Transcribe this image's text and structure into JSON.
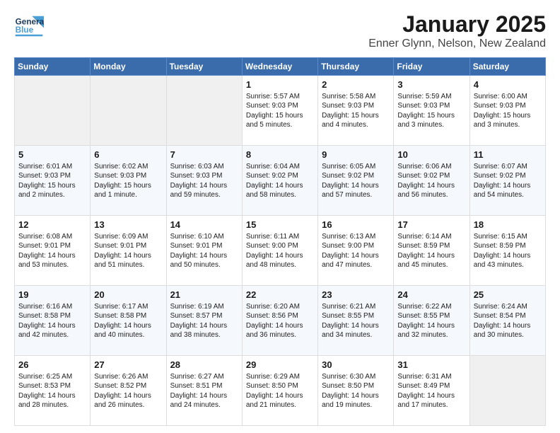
{
  "header": {
    "logo_line1": "General",
    "logo_line2": "Blue",
    "title": "January 2025",
    "subtitle": "Enner Glynn, Nelson, New Zealand"
  },
  "days_of_week": [
    "Sunday",
    "Monday",
    "Tuesday",
    "Wednesday",
    "Thursday",
    "Friday",
    "Saturday"
  ],
  "weeks": [
    [
      {
        "day": "",
        "empty": true
      },
      {
        "day": "",
        "empty": true
      },
      {
        "day": "",
        "empty": true
      },
      {
        "day": "1",
        "sunrise": "5:57 AM",
        "sunset": "9:03 PM",
        "daylight": "15 hours and 5 minutes."
      },
      {
        "day": "2",
        "sunrise": "5:58 AM",
        "sunset": "9:03 PM",
        "daylight": "15 hours and 4 minutes."
      },
      {
        "day": "3",
        "sunrise": "5:59 AM",
        "sunset": "9:03 PM",
        "daylight": "15 hours and 3 minutes."
      },
      {
        "day": "4",
        "sunrise": "6:00 AM",
        "sunset": "9:03 PM",
        "daylight": "15 hours and 3 minutes."
      }
    ],
    [
      {
        "day": "5",
        "sunrise": "6:01 AM",
        "sunset": "9:03 PM",
        "daylight": "15 hours and 2 minutes."
      },
      {
        "day": "6",
        "sunrise": "6:02 AM",
        "sunset": "9:03 PM",
        "daylight": "15 hours and 1 minute."
      },
      {
        "day": "7",
        "sunrise": "6:03 AM",
        "sunset": "9:03 PM",
        "daylight": "14 hours and 59 minutes."
      },
      {
        "day": "8",
        "sunrise": "6:04 AM",
        "sunset": "9:02 PM",
        "daylight": "14 hours and 58 minutes."
      },
      {
        "day": "9",
        "sunrise": "6:05 AM",
        "sunset": "9:02 PM",
        "daylight": "14 hours and 57 minutes."
      },
      {
        "day": "10",
        "sunrise": "6:06 AM",
        "sunset": "9:02 PM",
        "daylight": "14 hours and 56 minutes."
      },
      {
        "day": "11",
        "sunrise": "6:07 AM",
        "sunset": "9:02 PM",
        "daylight": "14 hours and 54 minutes."
      }
    ],
    [
      {
        "day": "12",
        "sunrise": "6:08 AM",
        "sunset": "9:01 PM",
        "daylight": "14 hours and 53 minutes."
      },
      {
        "day": "13",
        "sunrise": "6:09 AM",
        "sunset": "9:01 PM",
        "daylight": "14 hours and 51 minutes."
      },
      {
        "day": "14",
        "sunrise": "6:10 AM",
        "sunset": "9:01 PM",
        "daylight": "14 hours and 50 minutes."
      },
      {
        "day": "15",
        "sunrise": "6:11 AM",
        "sunset": "9:00 PM",
        "daylight": "14 hours and 48 minutes."
      },
      {
        "day": "16",
        "sunrise": "6:13 AM",
        "sunset": "9:00 PM",
        "daylight": "14 hours and 47 minutes."
      },
      {
        "day": "17",
        "sunrise": "6:14 AM",
        "sunset": "8:59 PM",
        "daylight": "14 hours and 45 minutes."
      },
      {
        "day": "18",
        "sunrise": "6:15 AM",
        "sunset": "8:59 PM",
        "daylight": "14 hours and 43 minutes."
      }
    ],
    [
      {
        "day": "19",
        "sunrise": "6:16 AM",
        "sunset": "8:58 PM",
        "daylight": "14 hours and 42 minutes."
      },
      {
        "day": "20",
        "sunrise": "6:17 AM",
        "sunset": "8:58 PM",
        "daylight": "14 hours and 40 minutes."
      },
      {
        "day": "21",
        "sunrise": "6:19 AM",
        "sunset": "8:57 PM",
        "daylight": "14 hours and 38 minutes."
      },
      {
        "day": "22",
        "sunrise": "6:20 AM",
        "sunset": "8:56 PM",
        "daylight": "14 hours and 36 minutes."
      },
      {
        "day": "23",
        "sunrise": "6:21 AM",
        "sunset": "8:55 PM",
        "daylight": "14 hours and 34 minutes."
      },
      {
        "day": "24",
        "sunrise": "6:22 AM",
        "sunset": "8:55 PM",
        "daylight": "14 hours and 32 minutes."
      },
      {
        "day": "25",
        "sunrise": "6:24 AM",
        "sunset": "8:54 PM",
        "daylight": "14 hours and 30 minutes."
      }
    ],
    [
      {
        "day": "26",
        "sunrise": "6:25 AM",
        "sunset": "8:53 PM",
        "daylight": "14 hours and 28 minutes."
      },
      {
        "day": "27",
        "sunrise": "6:26 AM",
        "sunset": "8:52 PM",
        "daylight": "14 hours and 26 minutes."
      },
      {
        "day": "28",
        "sunrise": "6:27 AM",
        "sunset": "8:51 PM",
        "daylight": "14 hours and 24 minutes."
      },
      {
        "day": "29",
        "sunrise": "6:29 AM",
        "sunset": "8:50 PM",
        "daylight": "14 hours and 21 minutes."
      },
      {
        "day": "30",
        "sunrise": "6:30 AM",
        "sunset": "8:50 PM",
        "daylight": "14 hours and 19 minutes."
      },
      {
        "day": "31",
        "sunrise": "6:31 AM",
        "sunset": "8:49 PM",
        "daylight": "14 hours and 17 minutes."
      },
      {
        "day": "",
        "empty": true
      }
    ]
  ]
}
